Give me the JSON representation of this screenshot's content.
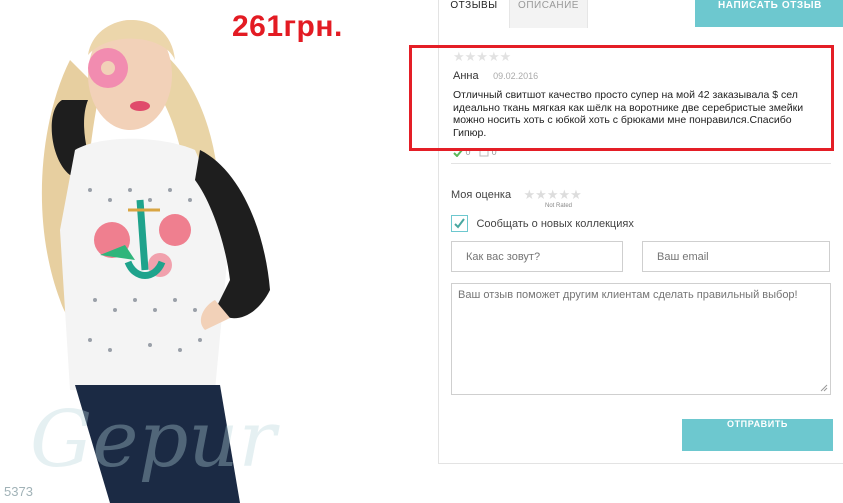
{
  "product": {
    "price": "261грн.",
    "sku": "5373",
    "watermark": "Gepur"
  },
  "tabs": {
    "reviews": "отзывы",
    "description": "описание",
    "write_review": "написать отзыв"
  },
  "review": {
    "stars": "★★★★★",
    "author": "Анна",
    "date": "09.02.2016",
    "text": "Отличный свитшот качество просто супер на мой 42 заказывала $ сел идеально ткань мягкая как шёлк на воротнике две серебристые змейки можно носить хоть с юбкой хоть с брюками мне понравился.Спасибо Гипюр.",
    "likes": "0",
    "dislikes": "0"
  },
  "form": {
    "my_rating_label": "Моя оценка",
    "rating_stars": "★★★★★",
    "not_rated": "Not Rated",
    "subscribe_label": "Сообщать о новых коллекциях",
    "subscribe_checked": true,
    "name_placeholder": "Как вас зовут?",
    "email_placeholder": "Ваш email",
    "review_placeholder": "Ваш отзыв поможет другим клиентам сделать правильный выбор!",
    "submit_label": "отправить"
  },
  "colors": {
    "price": "#e31b23",
    "accent": "#6dc8cf",
    "highlight": "#e41e26"
  }
}
